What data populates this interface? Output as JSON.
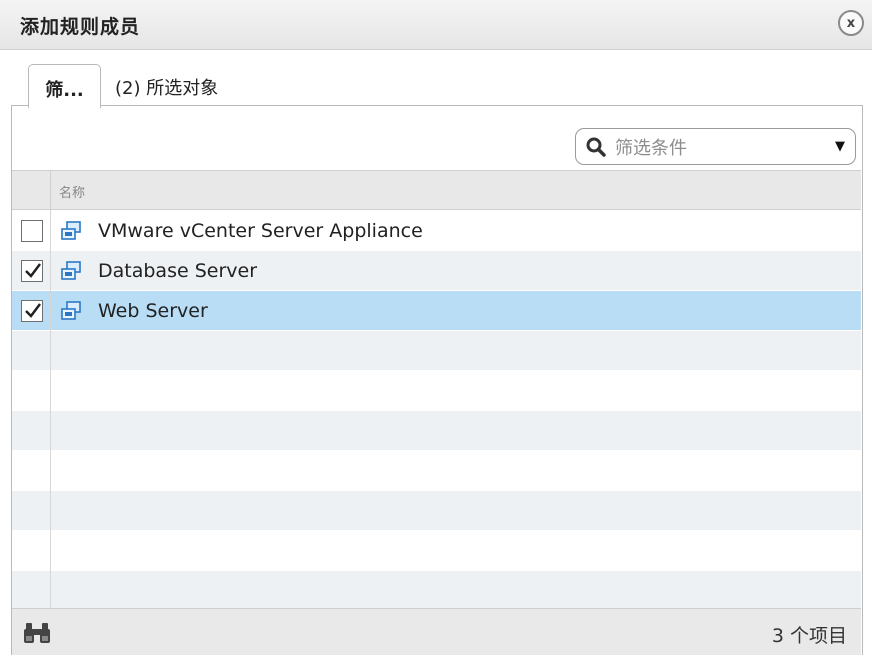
{
  "dialog": {
    "title": "添加规则成员",
    "close_label": "x"
  },
  "tabs": [
    {
      "label": "筛...",
      "active": true
    },
    {
      "label": "(2) 所选对象",
      "active": false
    }
  ],
  "filter": {
    "placeholder": "筛选条件"
  },
  "table": {
    "columns": [
      "名称"
    ],
    "rows": [
      {
        "name": "VMware vCenter Server Appliance",
        "checked": false,
        "selected": false,
        "icon": "vm-icon"
      },
      {
        "name": "Database Server",
        "checked": true,
        "selected": false,
        "icon": "vm-icon"
      },
      {
        "name": "Web Server",
        "checked": true,
        "selected": true,
        "icon": "vm-icon"
      }
    ]
  },
  "footer": {
    "count_text": "3 个项目",
    "icon": "binoculars-icon"
  },
  "colors": {
    "selected_row": "#b8ddf5",
    "alt_row": "#eef1f4",
    "header_bg": "#e8e8e8",
    "icon_blue": "#2a78c4"
  }
}
